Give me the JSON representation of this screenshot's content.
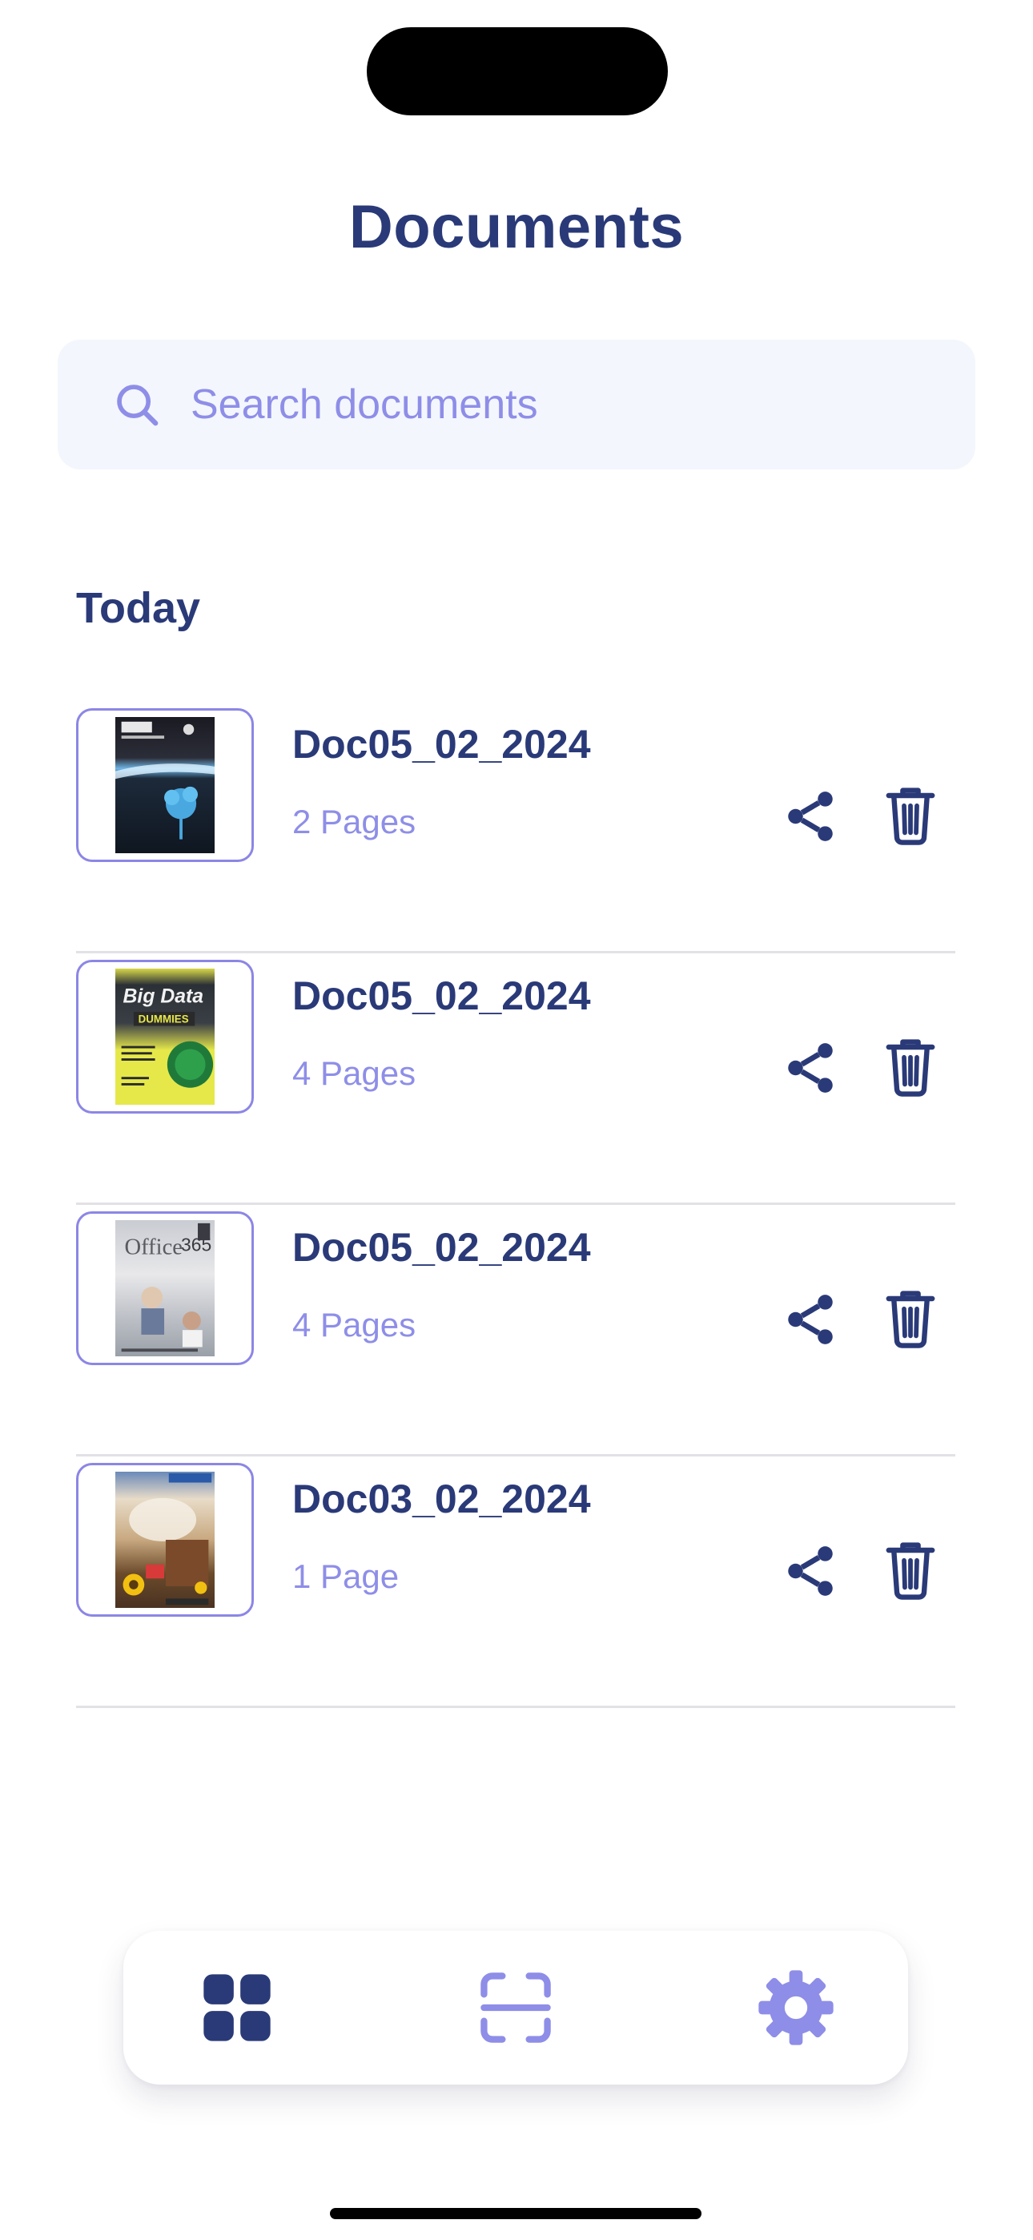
{
  "header": {
    "title": "Documents"
  },
  "search": {
    "placeholder": "Search documents",
    "value": ""
  },
  "sections": [
    {
      "heading": "Today",
      "documents": [
        {
          "name": "Doc05_02_2024",
          "pages": "2 Pages",
          "thumbnail": "book-cover-dark-blue"
        },
        {
          "name": "Doc05_02_2024",
          "pages": "4 Pages",
          "thumbnail": "book-cover-yellow-green"
        },
        {
          "name": "Doc05_02_2024",
          "pages": "4 Pages",
          "thumbnail": "book-cover-grey-white"
        },
        {
          "name": "Doc03_02_2024",
          "pages": "1 Page",
          "thumbnail": "book-cover-brown-floral"
        }
      ]
    }
  ],
  "tabbar": {
    "items": [
      {
        "icon": "grid-icon",
        "active": true
      },
      {
        "icon": "scan-icon",
        "active": false
      },
      {
        "icon": "gear-icon",
        "active": false
      }
    ]
  },
  "colors": {
    "primary": "#2a3a78",
    "accent": "#8e8ee8",
    "search_bg": "#f3f6fd",
    "divider": "#e2e2e6",
    "thumb_border": "#8c86e6"
  }
}
